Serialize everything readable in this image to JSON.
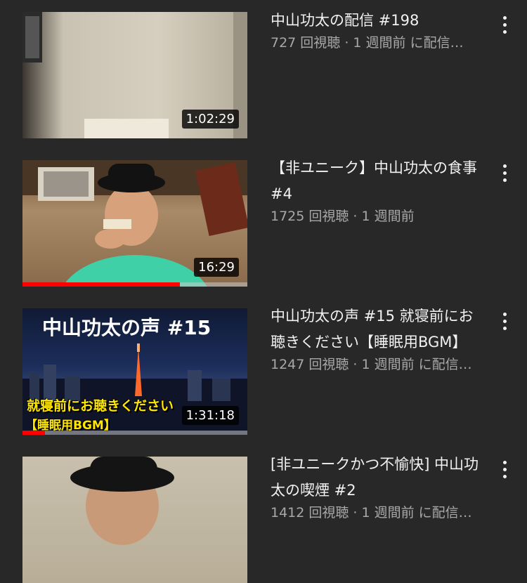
{
  "videos": [
    {
      "title": "中山功太の配信 #198",
      "meta": "727 回視聴 · 1 週間前 に配信…",
      "duration": "1:02:29",
      "progress": 0
    },
    {
      "title": "【非ユニーク】中山功太の食事 #4",
      "meta": "1725 回視聴 · 1 週間前",
      "duration": "16:29",
      "progress": 0.7
    },
    {
      "title": "中山功太の声 #15 就寝前にお聴きください【睡眠用BGM】",
      "meta": "1247 回視聴 · 1 週間前 に配信…",
      "duration": "1:31:18",
      "progress": 0.1,
      "thumb_text": {
        "heading": "中山功太の声 #15",
        "line1": "就寝前にお聴きください",
        "line2": "【睡眠用BGM】"
      }
    },
    {
      "title": "[非ユニークかつ不愉快] 中山功太の喫煙 #2",
      "meta": "1412 回視聴 · 1 週間前 に配信…"
    }
  ],
  "colors": {
    "background": "#282828",
    "progress": "#ff0000",
    "meta_text": "#a8a8a8"
  }
}
